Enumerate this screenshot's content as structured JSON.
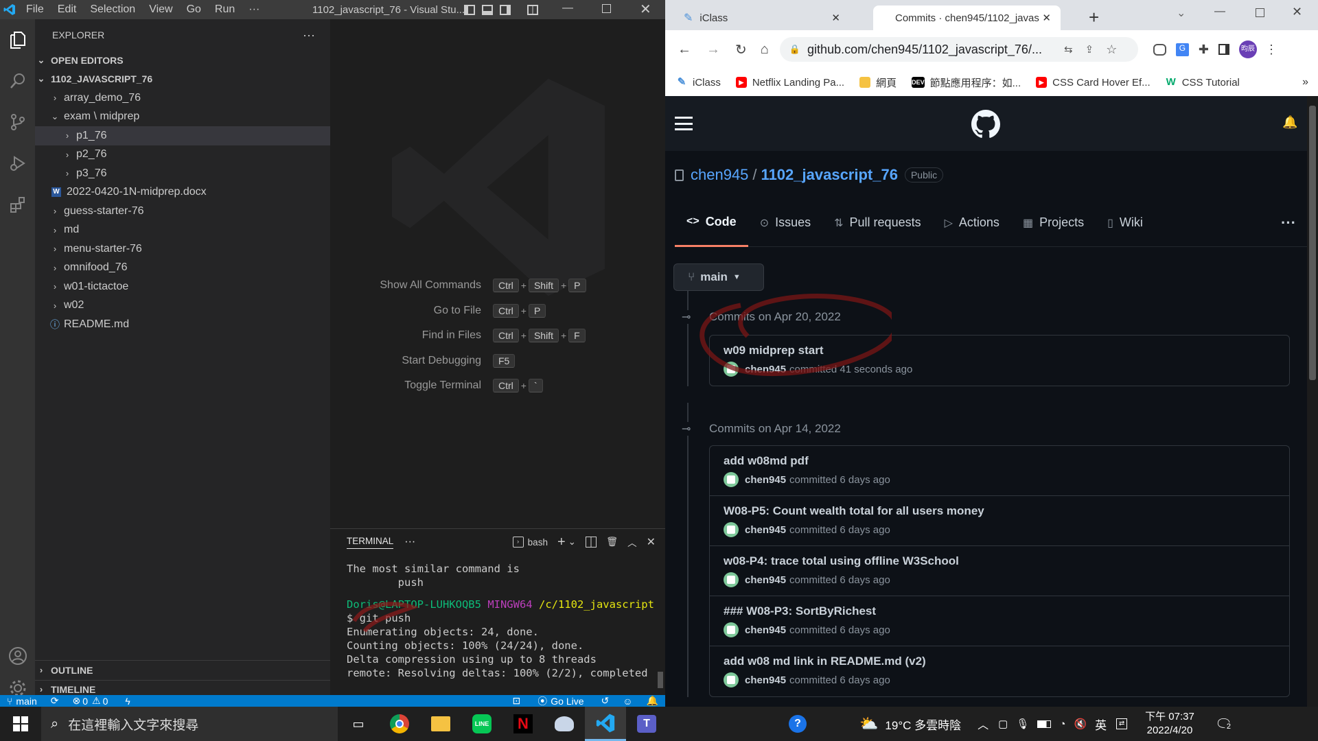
{
  "vscode": {
    "title": "1102_javascript_76 - Visual Stu...",
    "menu": [
      "File",
      "Edit",
      "Selection",
      "View",
      "Go",
      "Run",
      "···"
    ],
    "explorer_label": "EXPLORER",
    "open_editors": "OPEN EDITORS",
    "workspace": "1102_JAVASCRIPT_76",
    "tree": [
      {
        "label": "array_demo_76",
        "type": "folder"
      },
      {
        "label": "exam \\ midprep",
        "type": "folder-open"
      },
      {
        "label": "p1_76",
        "type": "folder-sub",
        "selected": true
      },
      {
        "label": "p2_76",
        "type": "folder-sub"
      },
      {
        "label": "p3_76",
        "type": "folder-sub"
      },
      {
        "label": "2022-0420-1N-midprep.docx",
        "type": "file-docx"
      },
      {
        "label": "guess-starter-76",
        "type": "folder"
      },
      {
        "label": "md",
        "type": "folder"
      },
      {
        "label": "menu-starter-76",
        "type": "folder"
      },
      {
        "label": "omnifood_76",
        "type": "folder"
      },
      {
        "label": "w01-tictactoe",
        "type": "folder"
      },
      {
        "label": "w02",
        "type": "folder"
      },
      {
        "label": "README.md",
        "type": "file-info"
      }
    ],
    "outline": "OUTLINE",
    "timeline": "TIMELINE",
    "shortcuts": [
      {
        "label": "Show All Commands",
        "keys": [
          "Ctrl",
          "Shift",
          "P"
        ]
      },
      {
        "label": "Go to File",
        "keys": [
          "Ctrl",
          "P"
        ]
      },
      {
        "label": "Find in Files",
        "keys": [
          "Ctrl",
          "Shift",
          "F"
        ]
      },
      {
        "label": "Start Debugging",
        "keys": [
          "F5"
        ]
      },
      {
        "label": "Toggle Terminal",
        "keys": [
          "Ctrl",
          "`"
        ]
      }
    ],
    "terminal": {
      "tab": "TERMINAL",
      "shell": "bash",
      "lines": [
        {
          "text": "The most similar command is",
          "color": "#cccccc"
        },
        {
          "text": "        push",
          "color": "#cccccc"
        },
        {
          "text": "",
          "color": "#cccccc"
        },
        {
          "prompt_user": "Doris@LAPTOP-LUHKOQB5",
          "prompt_env": "MINGW64",
          "prompt_path": "/c/1102_javascript"
        },
        {
          "text": "$ git push",
          "color": "#cccccc"
        },
        {
          "text": "Enumerating objects: 24, done.",
          "color": "#cccccc"
        },
        {
          "text": "Counting objects: 100% (24/24), done.",
          "color": "#cccccc"
        },
        {
          "text": "Delta compression using up to 8 threads",
          "color": "#cccccc"
        },
        {
          "text": "remote: Resolving deltas: 100% (2/2), completed",
          "color": "#cccccc"
        }
      ]
    },
    "status": {
      "branch": "main",
      "errors": "0",
      "warnings": "0",
      "golive": "Go Live"
    }
  },
  "chrome": {
    "tabs": [
      {
        "title": "iClass",
        "active": false
      },
      {
        "title": "Commits · chen945/1102_javas",
        "active": true
      }
    ],
    "url": "github.com/chen945/1102_javascript_76/...",
    "profile": "昀辰",
    "bookmarks": [
      {
        "label": "iClass",
        "icon": "iclass"
      },
      {
        "label": "Netflix Landing Pa...",
        "icon": "youtube"
      },
      {
        "label": "網頁",
        "icon": "folder"
      },
      {
        "label": "節點應用程序：如...",
        "icon": "dev"
      },
      {
        "label": "CSS Card Hover Ef...",
        "icon": "youtube"
      },
      {
        "label": "CSS Tutorial",
        "icon": "w3"
      }
    ]
  },
  "github": {
    "owner": "chen945",
    "repo": "1102_javascript_76",
    "visibility": "Public",
    "nav": [
      "Code",
      "Issues",
      "Pull requests",
      "Actions",
      "Projects",
      "Wiki"
    ],
    "branch": "main",
    "groups": [
      {
        "date": "Commits on Apr 20, 2022",
        "commits": [
          {
            "title": "w09 midprep start",
            "author": "chen945",
            "time": "committed 41 seconds ago"
          }
        ]
      },
      {
        "date": "Commits on Apr 14, 2022",
        "commits": [
          {
            "title": "add w08md pdf",
            "author": "chen945",
            "time": "committed 6 days ago"
          },
          {
            "title": "W08-P5: Count wealth total for all users money",
            "author": "chen945",
            "time": "committed 6 days ago"
          },
          {
            "title": "w08-P4: trace total using offline W3School",
            "author": "chen945",
            "time": "committed 6 days ago"
          },
          {
            "title": "### W08-P3: SortByRichest",
            "author": "chen945",
            "time": "committed 6 days ago"
          },
          {
            "title": "add w08 md link in README.md (v2)",
            "author": "chen945",
            "time": "committed 6 days ago"
          }
        ]
      }
    ]
  },
  "taskbar": {
    "search_placeholder": "在這裡輸入文字來搜尋",
    "weather": "19°C 多雲時陰",
    "ime": "英",
    "time": "下午 07:37",
    "date": "2022/4/20",
    "notif_count": "2"
  }
}
